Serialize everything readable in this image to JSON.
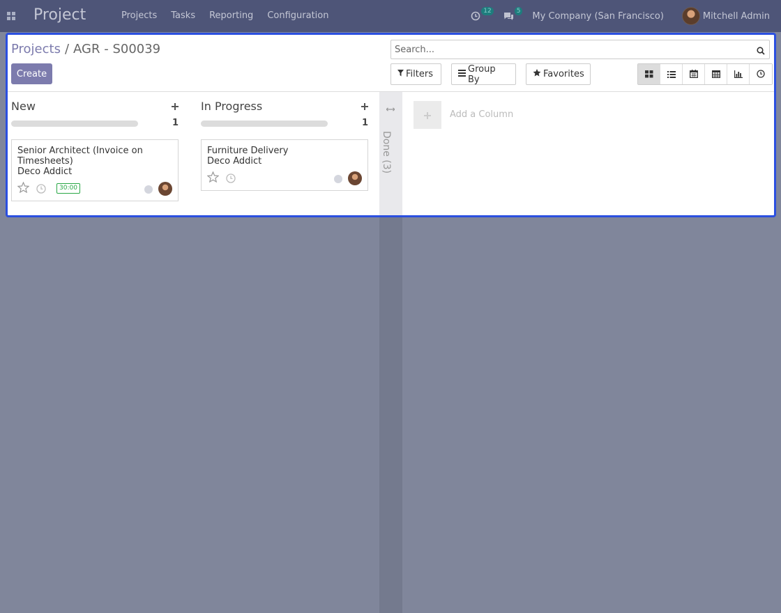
{
  "navbar": {
    "app_title": "Project",
    "menu": [
      "Projects",
      "Tasks",
      "Reporting",
      "Configuration"
    ],
    "activity_count": "12",
    "message_count": "5",
    "company": "My Company (San Francisco)",
    "user": "Mitchell Admin"
  },
  "breadcrumb": {
    "parent": "Projects",
    "separator": "/",
    "current": "AGR - S00039"
  },
  "toolbar": {
    "create_label": "Create",
    "search_placeholder": "Search...",
    "filters_label": "Filters",
    "group_by_label": "Group By",
    "favorites_label": "Favorites",
    "views": [
      "kanban",
      "list",
      "calendar",
      "pivot",
      "graph",
      "activity"
    ],
    "active_view": "kanban"
  },
  "columns": [
    {
      "title": "New",
      "count": "1",
      "cards": [
        {
          "name": "Senior Architect (Invoice on Timesheets)",
          "partner": "Deco Addict",
          "hours": "30:00"
        }
      ]
    },
    {
      "title": "In Progress",
      "count": "1",
      "cards": [
        {
          "name": "Furniture Delivery",
          "partner": "Deco Addict",
          "hours": ""
        }
      ]
    }
  ],
  "folded_column": {
    "label": "Done (3)"
  },
  "add_column_label": "Add a Column",
  "colors": {
    "navbar": "#4e5578",
    "primary": "#7c7bad",
    "highlight_frame": "#2b4fe0",
    "success": "#28a745"
  }
}
